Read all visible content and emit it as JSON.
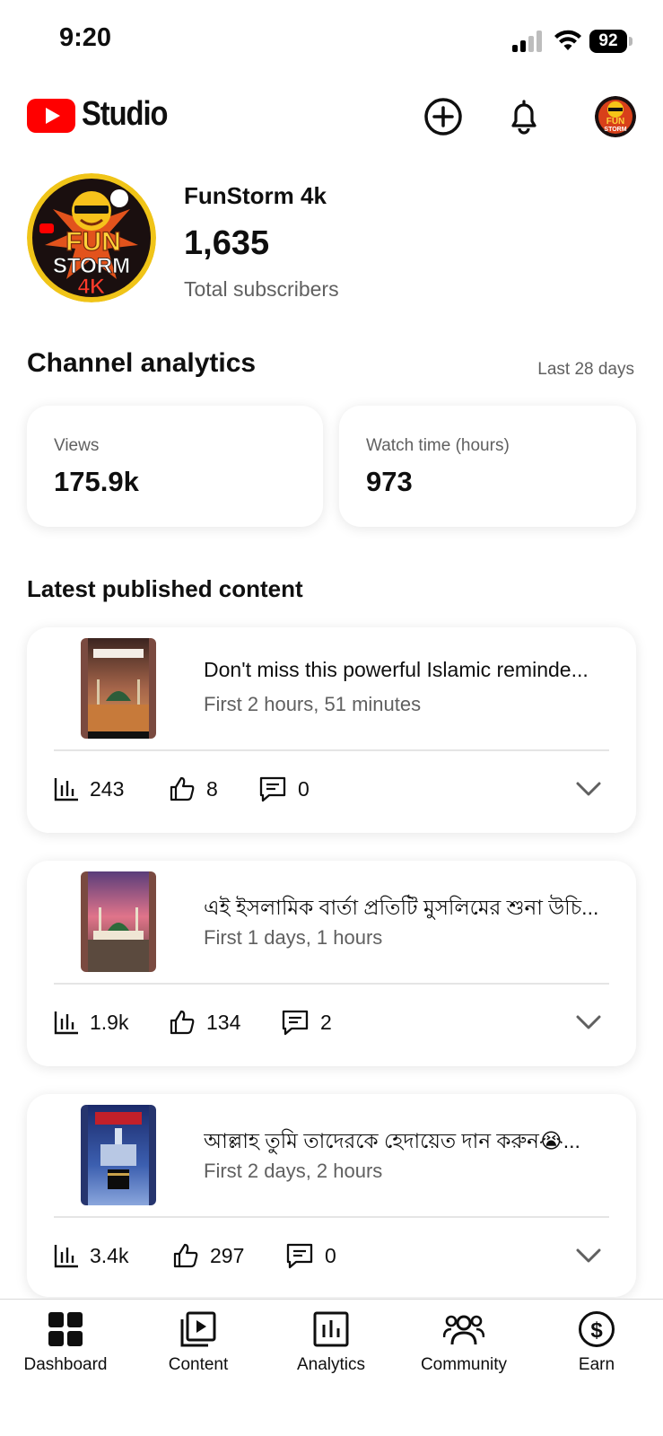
{
  "status_bar": {
    "time": "9:20",
    "battery": "92"
  },
  "header": {
    "app_name": "Studio",
    "icons": [
      "create-icon",
      "bell-icon",
      "account-avatar"
    ]
  },
  "channel": {
    "name": "FunStorm 4k",
    "subscribers": "1,635",
    "subscribers_label": "Total subscribers",
    "avatar_text": {
      "line1": "FUN",
      "line2": "STORM",
      "line3": "4K"
    }
  },
  "analytics": {
    "title": "Channel analytics",
    "period": "Last 28 days",
    "metrics": [
      {
        "label": "Views",
        "value": "175.9k"
      },
      {
        "label": "Watch time (hours)",
        "value": "973"
      }
    ]
  },
  "latest": {
    "title": "Latest published content",
    "videos": [
      {
        "title": "Don't miss this powerful Islamic reminde...",
        "subtitle": "First 2 hours, 51 minutes",
        "views": "243",
        "likes": "8",
        "comments": "0"
      },
      {
        "title": "এই ইসলামিক বার্তা প্রতিটি মুসলিমের শুনা উচি...",
        "subtitle": "First 1 days, 1 hours",
        "views": "1.9k",
        "likes": "134",
        "comments": "2"
      },
      {
        "title": "আল্লাহ তুমি তাদেরকে হেদায়েত দান করুন😭...",
        "subtitle": "First 2 days, 2 hours",
        "views": "3.4k",
        "likes": "297",
        "comments": "0"
      }
    ]
  },
  "nav": {
    "items": [
      {
        "label": "Dashboard",
        "icon": "dashboard-icon"
      },
      {
        "label": "Content",
        "icon": "content-icon"
      },
      {
        "label": "Analytics",
        "icon": "analytics-icon"
      },
      {
        "label": "Community",
        "icon": "community-icon"
      },
      {
        "label": "Earn",
        "icon": "earn-icon"
      }
    ]
  },
  "colors": {
    "brand_red": "#ff0000",
    "text": "#0f0f0f",
    "secondary_text": "#606060"
  }
}
